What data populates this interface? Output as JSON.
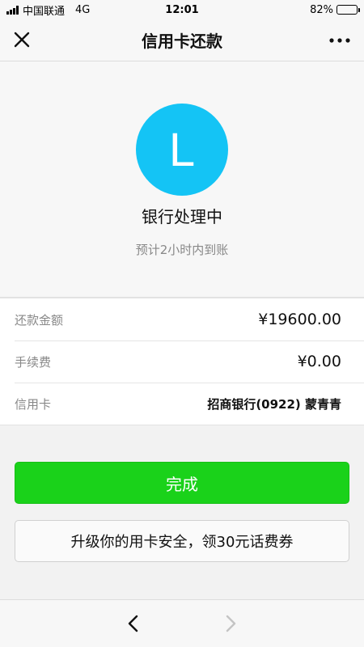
{
  "status_bar": {
    "carrier": "中国联通",
    "network": "4G",
    "time": "12:01",
    "battery": "82%",
    "battery_level": 82
  },
  "nav": {
    "title": "信用卡还款",
    "close_icon": "close-icon",
    "more_icon": "more-icon"
  },
  "status": {
    "avatar_letter": "L",
    "avatar_color": "#14c4f5",
    "title": "银行处理中",
    "subtitle": "预计2小时内到账"
  },
  "details": [
    {
      "label": "还款金额",
      "value": "¥19600.00"
    },
    {
      "label": "手续费",
      "value": "¥0.00"
    },
    {
      "label": "信用卡",
      "value": "招商银行(0922) 蒙青青"
    }
  ],
  "buttons": {
    "done": "完成",
    "done_color": "#1ad21a",
    "promo": "升级你的用卡安全，领30元话费券"
  },
  "bottom_bar": {
    "back_icon": "chevron-left-icon",
    "forward_icon": "chevron-right-icon"
  }
}
